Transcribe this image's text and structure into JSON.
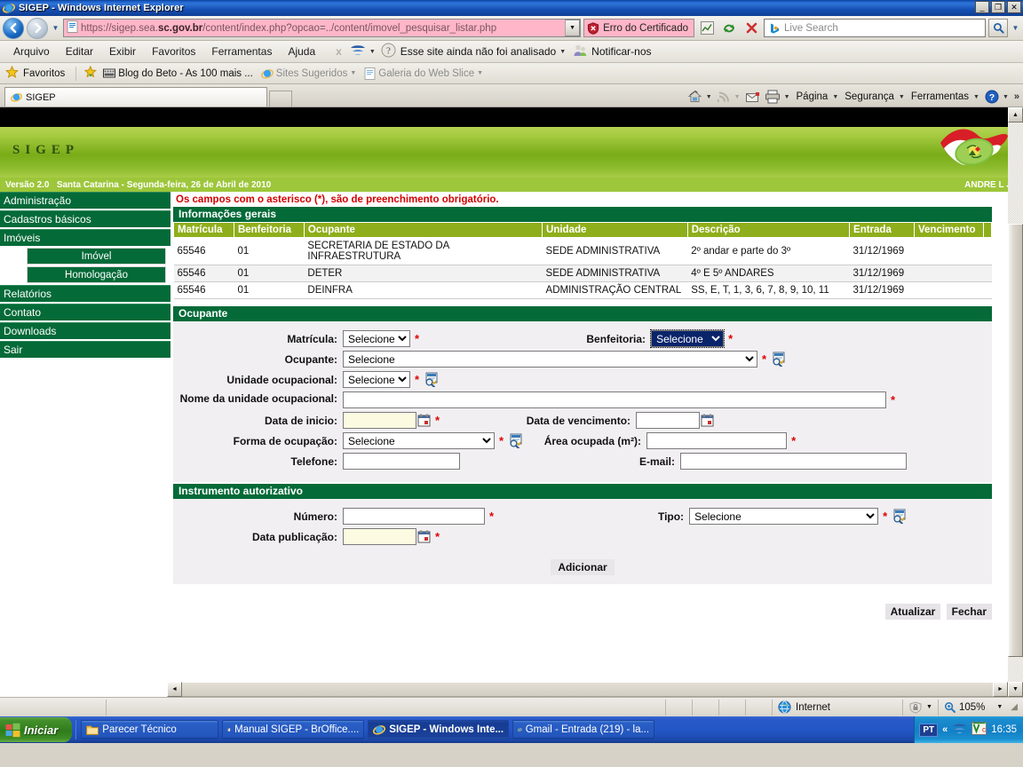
{
  "window": {
    "title": "SIGEP - Windows Internet Explorer",
    "minimize": "_",
    "restore": "❐",
    "close": "✕"
  },
  "address": {
    "url_prefix": "https://sigep.sea.",
    "url_bold": "sc.gov.br",
    "url_suffix": "/content/index.php?opcao=../content/imovel_pesquisar_listar.php",
    "cert_error": "Erro do Certificado",
    "search_placeholder": "Live Search"
  },
  "menu": {
    "items": [
      "Arquivo",
      "Editar",
      "Exibir",
      "Favoritos",
      "Ferramentas",
      "Ajuda"
    ],
    "x_label": "x",
    "site_status": "Esse site ainda não foi analisado",
    "notify": "Notificar-nos"
  },
  "favorites": {
    "label": "Favoritos",
    "items": [
      {
        "label": "Blog do Beto - As 100 mais ...",
        "dim": false
      },
      {
        "label": "Sites Sugeridos",
        "dim": true
      },
      {
        "label": "Galeria do Web Slice",
        "dim": true
      }
    ]
  },
  "tabs": {
    "active": "SIGEP"
  },
  "commandbar": {
    "items": [
      "Página",
      "Segurança",
      "Ferramentas"
    ],
    "overflow": "»"
  },
  "app": {
    "logo": "SIGEP",
    "version": "Versão 2.0",
    "date_line": "Santa Catarina - Segunda-feira, 26 de Abril de 2010",
    "user": "ANDRE L JR"
  },
  "sidebar": {
    "items": [
      {
        "label": "Administração",
        "sub": false
      },
      {
        "label": "Cadastros básicos",
        "sub": false
      },
      {
        "label": "Imóveis",
        "sub": false
      },
      {
        "label": "Imóvel",
        "sub": true
      },
      {
        "label": "Homologação",
        "sub": true
      },
      {
        "label": "Relatórios",
        "sub": false
      },
      {
        "label": "Contato",
        "sub": false
      },
      {
        "label": "Downloads",
        "sub": false
      },
      {
        "label": "Sair",
        "sub": false
      }
    ]
  },
  "main": {
    "notice": "Os campos com o asterisco (*), são de preenchimento obrigatório.",
    "section_general": "Informações gerais",
    "table": {
      "headers": [
        "Matrícula",
        "Benfeitoria",
        "Ocupante",
        "Unidade",
        "Descrição",
        "Entrada",
        "Vencimento",
        ""
      ],
      "rows": [
        {
          "matricula": "65546",
          "benfeitoria": "01",
          "ocupante": "SECRETARIA DE ESTADO DA INFRAESTRUTURA",
          "unidade": "SEDE ADMINISTRATIVA",
          "descricao": "2º andar e parte do 3º",
          "entrada": "31/12/1969",
          "vencimento": ""
        },
        {
          "matricula": "65546",
          "benfeitoria": "01",
          "ocupante": "DETER",
          "unidade": "SEDE ADMINISTRATIVA",
          "descricao": "4º E 5º ANDARES",
          "entrada": "31/12/1969",
          "vencimento": ""
        },
        {
          "matricula": "65546",
          "benfeitoria": "01",
          "ocupante": "DEINFRA",
          "unidade": "ADMINISTRAÇÃO CENTRAL",
          "descricao": "SS, E, T, 1, 3, 6, 7, 8, 9, 10, 11",
          "entrada": "31/12/1969",
          "vencimento": ""
        }
      ]
    },
    "section_ocupante": "Ocupante",
    "section_instrumento": "Instrumento autorizativo",
    "form": {
      "matricula_label": "Matrícula:",
      "matricula_value": "Selecione",
      "benfeitoria_label": "Benfeitoria:",
      "benfeitoria_value": "Selecione",
      "ocupante_label": "Ocupante:",
      "ocupante_value": "Selecione",
      "unidade_ocupacional_label": "Unidade ocupacional:",
      "unidade_ocupacional_value": "Selecione",
      "nome_unidade_label": "Nome da unidade ocupacional:",
      "nome_unidade_value": "",
      "data_inicio_label": "Data de inicio:",
      "data_inicio_value": "",
      "data_vencimento_label": "Data de vencimento:",
      "data_vencimento_value": "",
      "forma_ocupacao_label": "Forma de ocupação:",
      "forma_ocupacao_value": "Selecione",
      "area_ocupada_label": "Área ocupada (m²):",
      "area_ocupada_value": "",
      "telefone_label": "Telefone:",
      "telefone_value": "",
      "email_label": "E-mail:",
      "email_value": "",
      "numero_label": "Número:",
      "numero_value": "",
      "tipo_label": "Tipo:",
      "tipo_value": "Selecione",
      "data_publicacao_label": "Data publicação:",
      "data_publicacao_value": ""
    },
    "buttons": {
      "adicionar": "Adicionar",
      "atualizar": "Atualizar",
      "fechar": "Fechar"
    }
  },
  "statusbar": {
    "zone": "Internet",
    "zoom": "105%"
  },
  "taskbar": {
    "start": "Iniciar",
    "items": [
      {
        "label": "Parecer Técnico",
        "active": false
      },
      {
        "label": "Manual SIGEP - BrOffice....",
        "active": false
      },
      {
        "label": "SIGEP - Windows Inte...",
        "active": true
      },
      {
        "label": "Gmail - Entrada (219) - la...",
        "active": false
      }
    ],
    "lang": "PT",
    "chevron": "«",
    "clock": "16:35"
  },
  "colors": {
    "brand_green": "#046A38",
    "table_header_green": "#8fae1b",
    "header_gradient_top": "#b6d253",
    "version_bar": "#9dc63b",
    "required_red": "#e00000",
    "notice_red": "#d40000",
    "url_pink": "#ffb6c8"
  }
}
